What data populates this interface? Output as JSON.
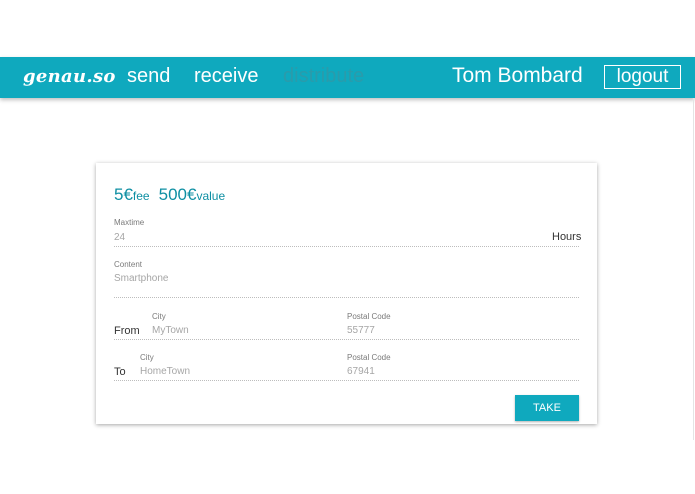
{
  "navbar": {
    "brand": "genau.so",
    "links": {
      "send": "send",
      "receive": "receive",
      "distribute": "distribute"
    },
    "user_name": "Tom Bombard",
    "logout_label": "logout"
  },
  "offer": {
    "fee_amount": "5€",
    "fee_label": "fee",
    "value_amount": "500€",
    "value_label": "value",
    "maxtime_label": "Maxtime",
    "maxtime_value": "24",
    "maxtime_unit": "Hours",
    "content_label": "Content",
    "content_value": "Smartphone",
    "from": {
      "label": "From",
      "city_label": "City",
      "city_value": "MyTown",
      "postal_label": "Postal Code",
      "postal_value": "55777"
    },
    "to": {
      "label": "To",
      "city_label": "City",
      "city_value": "HomeTown",
      "postal_label": "Postal Code",
      "postal_value": "67941"
    },
    "take_label": "TAKE"
  },
  "colors": {
    "accent": "#0fa9be",
    "price_text": "#0e8fa3",
    "inactive_nav": "#2a9bab"
  }
}
